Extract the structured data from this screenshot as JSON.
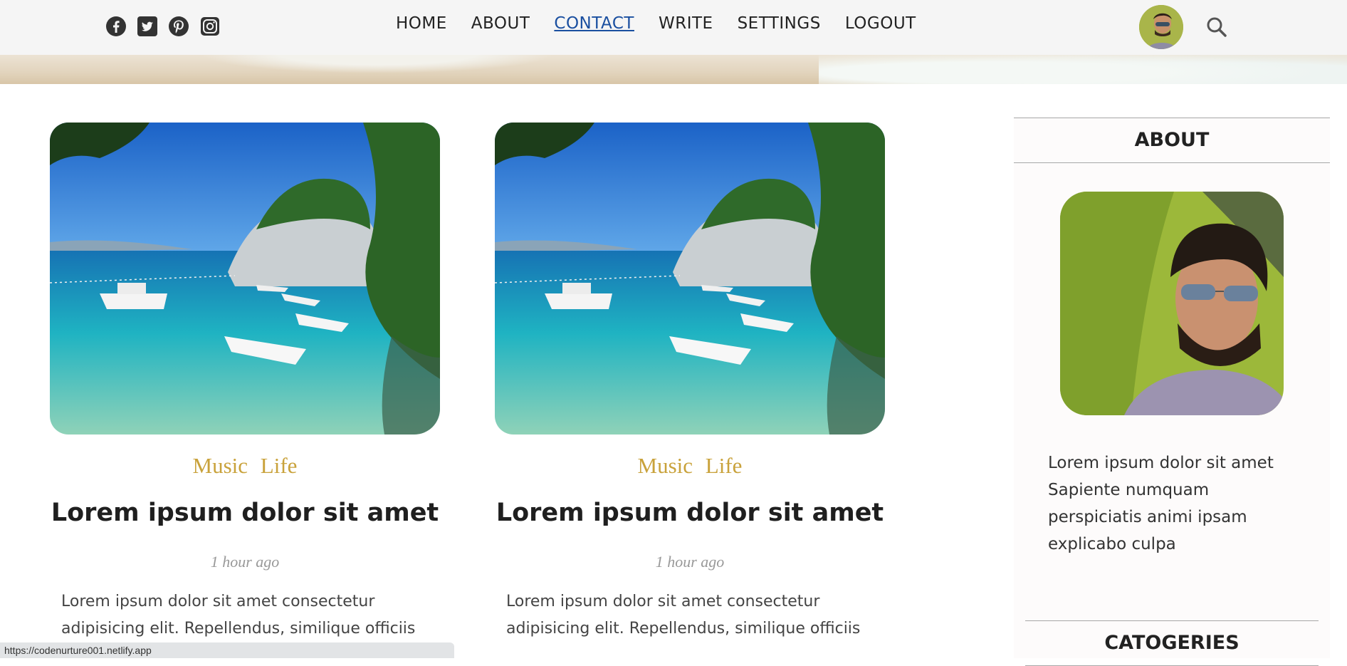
{
  "nav": {
    "social_icons": [
      "facebook-icon",
      "twitter-icon",
      "pinterest-icon",
      "instagram-icon"
    ],
    "links": [
      "HOME",
      "ABOUT",
      "CONTACT",
      "WRITE",
      "SETTINGS",
      "LOGOUT"
    ],
    "active_link": "CONTACT",
    "search_icon": "search-icon"
  },
  "posts": [
    {
      "categories": "Music Life",
      "title": "Lorem ipsum dolor sit amet",
      "date": "1 hour ago",
      "description": "Lorem ipsum dolor sit amet consectetur adipisicing elit. Repellendus, similique officiis"
    },
    {
      "categories": "Music Life",
      "title": "Lorem ipsum dolor sit amet",
      "date": "1 hour ago",
      "description": "Lorem ipsum dolor sit amet consectetur adipisicing elit. Repellendus, similique officiis"
    }
  ],
  "sidebar": {
    "about_title": "ABOUT",
    "about_text": "Lorem ipsum dolor sit amet Sapiente numquam perspiciatis animi ipsam explicabo culpa",
    "categories_title": "CATOGERIES"
  },
  "status_url": "https://codenurture001.netlify.app",
  "colors": {
    "category_accent": "#c9a23b",
    "active_link": "#1a4fa0",
    "topbar_bg": "#f5f5f5"
  }
}
